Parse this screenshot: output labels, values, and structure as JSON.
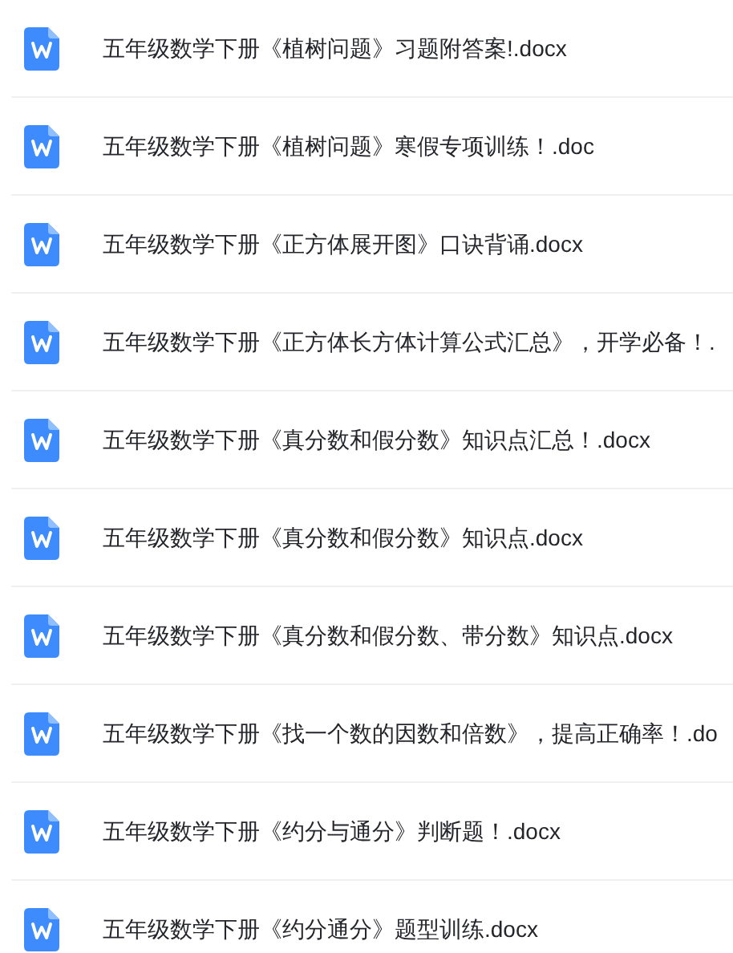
{
  "files": [
    {
      "name": "五年级数学下册《植树问题》习题附答案!.docx"
    },
    {
      "name": "五年级数学下册《植树问题》寒假专项训练！.doc"
    },
    {
      "name": "五年级数学下册《正方体展开图》口诀背诵.docx"
    },
    {
      "name": "五年级数学下册《正方体长方体计算公式汇总》，开学必备！."
    },
    {
      "name": "五年级数学下册《真分数和假分数》知识点汇总！.docx"
    },
    {
      "name": "五年级数学下册《真分数和假分数》知识点.docx"
    },
    {
      "name": "五年级数学下册《真分数和假分数、带分数》知识点.docx"
    },
    {
      "name": "五年级数学下册《找一个数的因数和倍数》，提高正确率！.do"
    },
    {
      "name": "五年级数学下册《约分与通分》判断题！.docx"
    },
    {
      "name": "五年级数学下册《约分通分》题型训练.docx"
    }
  ]
}
